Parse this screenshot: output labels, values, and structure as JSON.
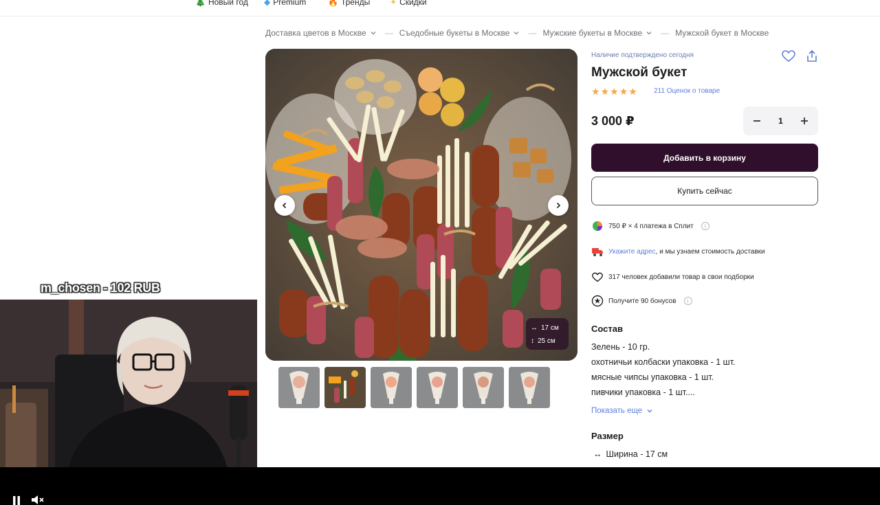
{
  "top_nav": {
    "items": [
      {
        "icon": "tree-icon",
        "label": "Новый год"
      },
      {
        "icon": "diamond-icon",
        "label": "Premium"
      },
      {
        "icon": "fire-icon",
        "label": "Тренды"
      },
      {
        "icon": "sparkle-icon",
        "label": "Скидки"
      }
    ]
  },
  "breadcrumbs": [
    "Доставка цветов в Москве",
    "Съедобные букеты в Москве",
    "Мужские букеты в Москве",
    "Мужской букет в Москве"
  ],
  "gallery": {
    "size_badge": {
      "width": "17 см",
      "height": "25 см"
    },
    "thumbnail_count": 6
  },
  "product": {
    "availability": "Наличие подтверждено сегодня",
    "title": "Мужской букет",
    "rating": 5,
    "reviews": "211 Оценок о товаре",
    "price": "3 000 ₽",
    "quantity": "1",
    "add_to_cart": "Добавить в корзину",
    "buy_now": "Купить сейчас"
  },
  "info": {
    "split": "750 ₽ × 4 платежа в Сплит",
    "delivery_link": "Укажите адрес",
    "delivery_text": ", и мы узнаем стоимость доставки",
    "favorites": "317 человек добавили товар в свои подборки",
    "bonus": "Получите 90 бонусов",
    "info_mark": "i"
  },
  "composition": {
    "title": "Состав",
    "items": [
      "Зелень - 10 гр.",
      "охотничьи колбаски упаковка - 1 шт.",
      "мясные чипсы упаковка - 1 шт.",
      "пивчики упаковка - 1 шт...."
    ],
    "show_more": "Показать еще"
  },
  "size": {
    "title": "Размер",
    "width": "Ширина - 17 см"
  },
  "stream": {
    "donation": "m_chosen - 102 RUB"
  },
  "colors": {
    "primary_button": "#2f0f2b",
    "link": "#5c7fd8",
    "stars": "#f3a840"
  }
}
